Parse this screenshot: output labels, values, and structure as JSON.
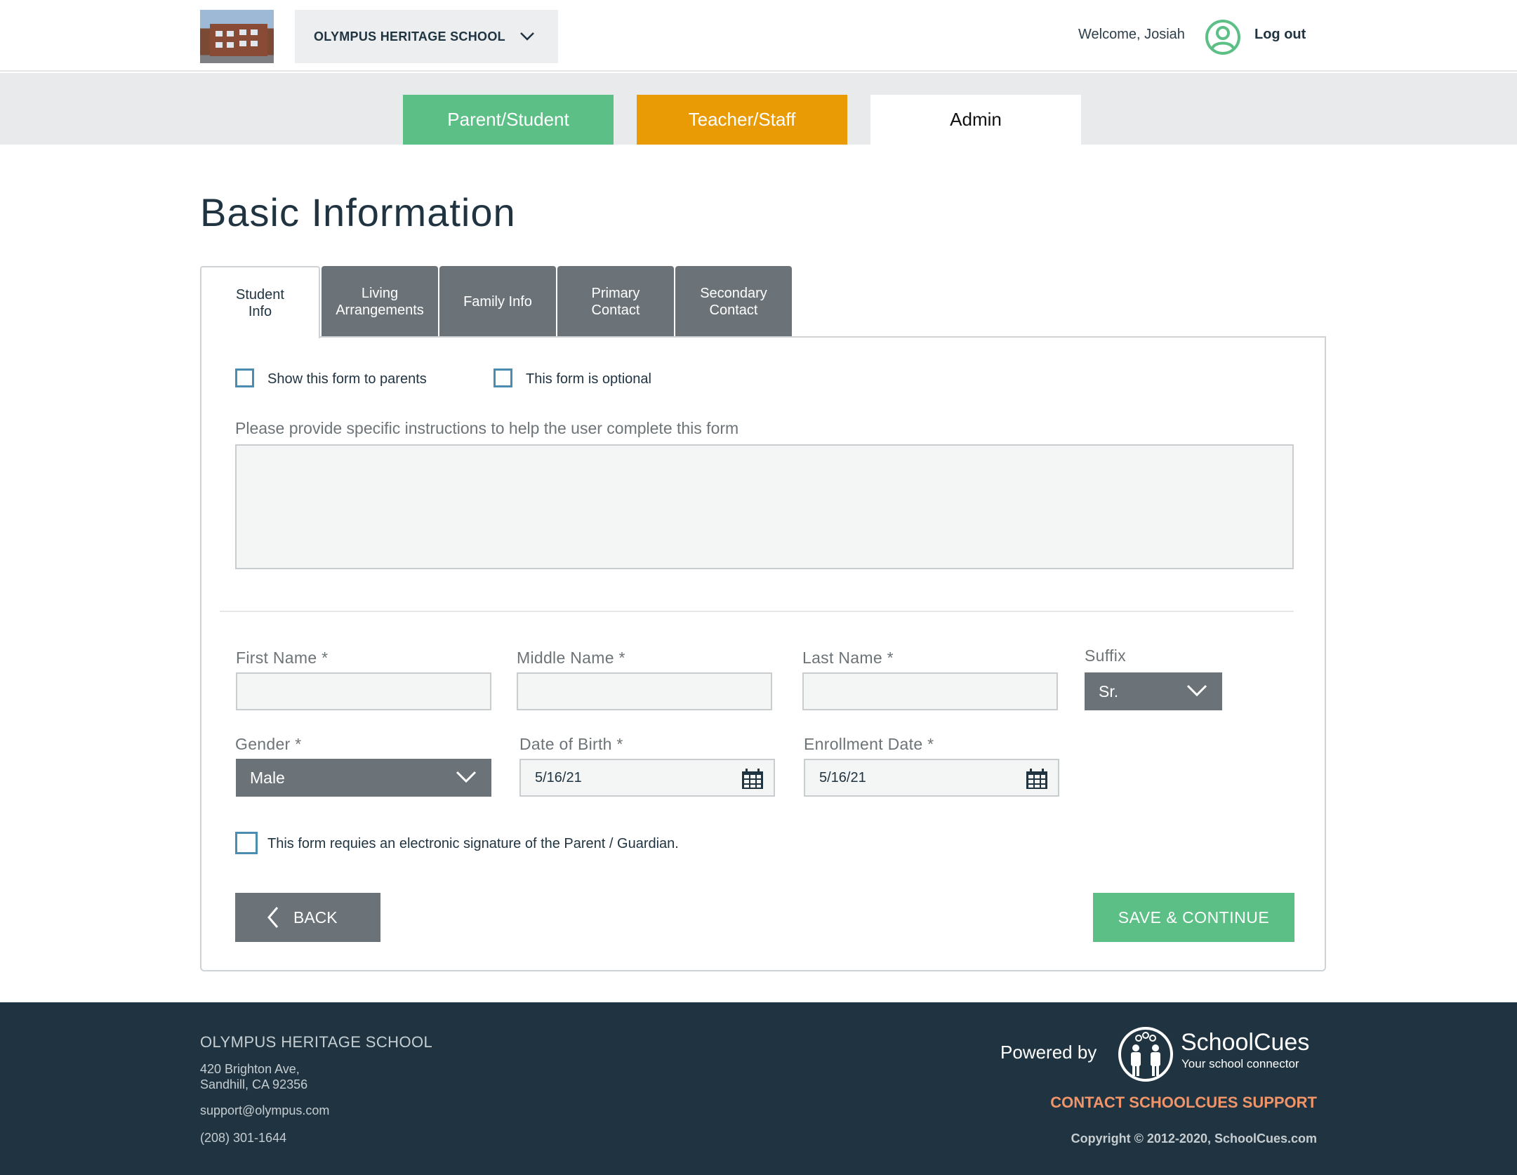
{
  "header": {
    "school_name": "OLYMPUS HERITAGE SCHOOL",
    "welcome": "Welcome, Josiah",
    "logout": "Log out"
  },
  "role_tabs": [
    {
      "label": "Parent/Student",
      "color": "#5bbf86"
    },
    {
      "label": "Teacher/Staff",
      "color": "#e89b05"
    },
    {
      "label": "Admin",
      "active": true
    }
  ],
  "page": {
    "title": "Basic Information"
  },
  "form_tabs": [
    {
      "label": "Student Info",
      "active": true
    },
    {
      "label": "Living Arrangements"
    },
    {
      "label": "Family Info"
    },
    {
      "label": "Primary Contact"
    },
    {
      "label": "Secondary Contact"
    }
  ],
  "options": {
    "show_to_parents": {
      "label": "Show this form to parents",
      "checked": false
    },
    "optional": {
      "label": "This form is optional",
      "checked": false
    }
  },
  "instructions": {
    "label": "Please provide specific instructions to help the user complete this form",
    "value": ""
  },
  "fields": {
    "first_name": {
      "label": "First Name *",
      "value": ""
    },
    "middle_name": {
      "label": "Middle Name *",
      "value": ""
    },
    "last_name": {
      "label": "Last Name *",
      "value": ""
    },
    "suffix": {
      "label": "Suffix",
      "value": "Sr."
    },
    "gender": {
      "label": "Gender *",
      "value": "Male"
    },
    "dob": {
      "label": "Date of Birth *",
      "value": "5/16/21"
    },
    "enrollment": {
      "label": "Enrollment Date *",
      "value": "5/16/21"
    }
  },
  "signature": {
    "label": "This form requies an electronic signature of the Parent / Guardian.",
    "checked": false
  },
  "buttons": {
    "back": "BACK",
    "save": "SAVE & CONTINUE"
  },
  "footer": {
    "school_name": "OLYMPUS HERITAGE SCHOOL",
    "address_line1": "420 Brighton Ave,",
    "address_line2": "Sandhill, CA 92356",
    "email": "support@olympus.com",
    "phone": "(208) 301-1644",
    "powered_by": "Powered by",
    "brand": "SchoolCues",
    "tagline": "Your school connector",
    "contact_support": "CONTACT SCHOOLCUES SUPPORT",
    "copyright": "Copyright © 2012-2020, SchoolCues.com"
  },
  "colors": {
    "green": "#5bbf86",
    "orange": "#e89b05",
    "gray": "#6b7378",
    "navy": "#1f3340",
    "checkbox": "#4a8db0",
    "contact": "#f0946a"
  }
}
